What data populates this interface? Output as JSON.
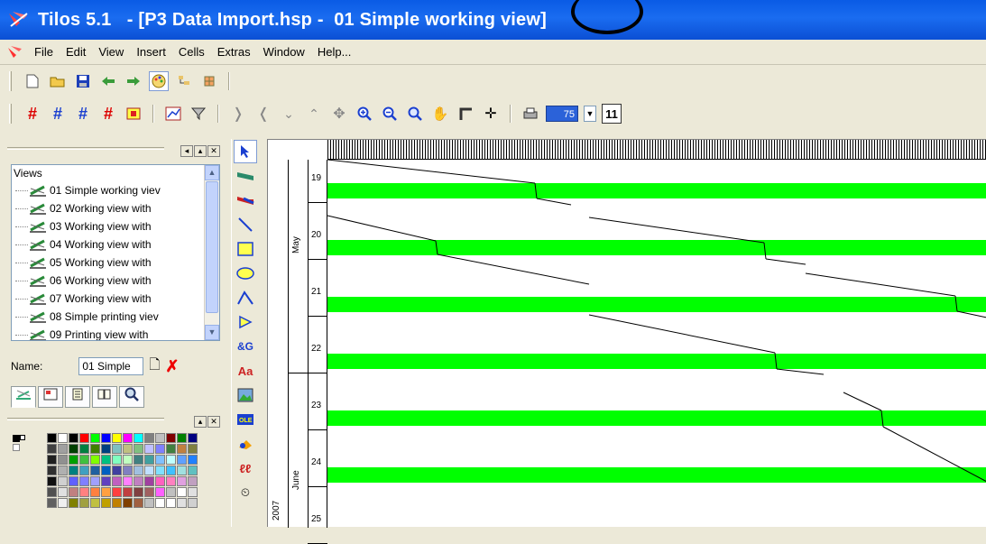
{
  "window": {
    "title": "Tilos 5.1   - [P3 Data Import.hsp -  01 Simple working view]"
  },
  "menu": [
    "File",
    "Edit",
    "View",
    "Insert",
    "Cells",
    "Extras",
    "Window",
    "Help..."
  ],
  "toolbar1": {
    "icons": [
      "new-file-icon",
      "open-folder-icon",
      "save-icon",
      "arrow-left-icon",
      "arrow-right-icon",
      "palette-icon",
      "tree-icon",
      "bug-icon"
    ]
  },
  "toolbar2": {
    "icons": [
      "grid-icon",
      "grid-red-icon",
      "grid-blue-icon",
      "grid-mixed-icon",
      "frame-icon",
      "chart-icon",
      "filter-icon",
      "undo-curve-icon",
      "redo-curve-icon",
      "down-chevron-icon",
      "up-chevron-icon",
      "crosshair-icon",
      "zoom-in-icon",
      "zoom-out-icon",
      "zoom-window-icon",
      "hand-icon",
      "corner-icon",
      "plus-cursor-icon",
      "printer-icon"
    ],
    "zoom_value": "75",
    "zoom_button_label": "11"
  },
  "views_panel": {
    "title": "Views",
    "items": [
      {
        "label": "01 Simple working viev"
      },
      {
        "label": "02 Working view with"
      },
      {
        "label": "03 Working view with"
      },
      {
        "label": "04 Working view with"
      },
      {
        "label": "05 Working view with"
      },
      {
        "label": "06 Working view with"
      },
      {
        "label": "07 Working view with"
      },
      {
        "label": "08 Simple printing viev"
      },
      {
        "label": "09 Printing view with"
      }
    ],
    "name_label": "Name:",
    "name_value": "01 Simple"
  },
  "tabs": [
    "views-tab-icon",
    "layout-tab-icon",
    "list-tab-icon",
    "book-tab-icon",
    "search-tab-icon"
  ],
  "tools": [
    "pointer-tool-icon",
    "line-bar-tool-icon",
    "curve-tool-icon",
    "line-tool-icon",
    "rectangle-tool-icon",
    "ellipse-tool-icon",
    "polyline-tool-icon",
    "polygon-tool-icon",
    "symbol-tool-icon",
    "text-tool-icon",
    "image-tool-icon",
    "ole-tool-icon",
    "shape-tool-icon",
    "dimension-tool-icon",
    "clock-tool-icon"
  ],
  "palette": {
    "colors": [
      "#000000",
      "#ffffff",
      "#000000",
      "#ff0000",
      "#00ff00",
      "#0000ff",
      "#ffff00",
      "#ff00ff",
      "#00ffff",
      "#808080",
      "#c0c0c0",
      "#800000",
      "#008000",
      "#000080",
      "#404040",
      "#a0a0a0",
      "#004000",
      "#008040",
      "#408000",
      "#004080",
      "#80c0c0",
      "#c0c080",
      "#80c080",
      "#c0c0ff",
      "#8080ff",
      "#408040",
      "#c08040",
      "#808040",
      "#202020",
      "#909090",
      "#00a000",
      "#40c040",
      "#80ff00",
      "#00c080",
      "#80ffc0",
      "#c0ffc0",
      "#408080",
      "#40a0a0",
      "#80c0ff",
      "#c0ffff",
      "#60a0ff",
      "#2080ff",
      "#303030",
      "#b0b0b0",
      "#008080",
      "#40a0c0",
      "#2060a0",
      "#0060c0",
      "#4040a0",
      "#8080c0",
      "#a0c0e0",
      "#c0e0ff",
      "#80e0ff",
      "#40c0ff",
      "#a0e0e0",
      "#60c0c0",
      "#101010",
      "#d0d0d0",
      "#6060ff",
      "#8080ff",
      "#a0a0ff",
      "#6040c0",
      "#c060c0",
      "#ff80ff",
      "#c080c0",
      "#a040a0",
      "#ff60c0",
      "#ff80c0",
      "#e0a0e0",
      "#c0a0c0",
      "#505050",
      "#e0e0e0",
      "#c08080",
      "#ff8080",
      "#ff8040",
      "#ffa040",
      "#ff4040",
      "#c04040",
      "#804040",
      "#a06060",
      "#ff60ff",
      "#c0c0c0",
      "#ffffff",
      "#e0e0e0",
      "#606060",
      "#f0f0f0",
      "#808000",
      "#a0a040",
      "#c0c040",
      "#c0a000",
      "#c08000",
      "#804000",
      "#a06040",
      "#c0c0c0",
      "#ffffff",
      "#ffffff",
      "#e0e0e0",
      "#d0d0d0"
    ]
  },
  "chart": {
    "year_label": "2007",
    "months": [
      {
        "name": "May",
        "from": 19,
        "to": 23
      },
      {
        "name": "June",
        "from": 23,
        "to": 26
      }
    ],
    "days": [
      "19",
      "20",
      "21",
      "22",
      "23",
      "24",
      "25"
    ]
  },
  "chart_data": {
    "type": "line",
    "title": "",
    "xlabel": "",
    "ylabel": "",
    "y_axis": {
      "unit": "day",
      "year": "2007",
      "ticks": [
        "19",
        "20",
        "21",
        "22",
        "23",
        "24",
        "25"
      ],
      "months": [
        "May",
        "June"
      ]
    },
    "bars": [
      {
        "day": 19,
        "color": "#00ff00"
      },
      {
        "day": 20,
        "color": "#00ff00"
      },
      {
        "day": 21,
        "color": "#00ff00"
      },
      {
        "day": 22,
        "color": "#00ff00"
      },
      {
        "day": 23,
        "color": "#00ff00"
      },
      {
        "day": 24,
        "color": "#00ff00"
      }
    ],
    "lines_color": "#000000"
  }
}
